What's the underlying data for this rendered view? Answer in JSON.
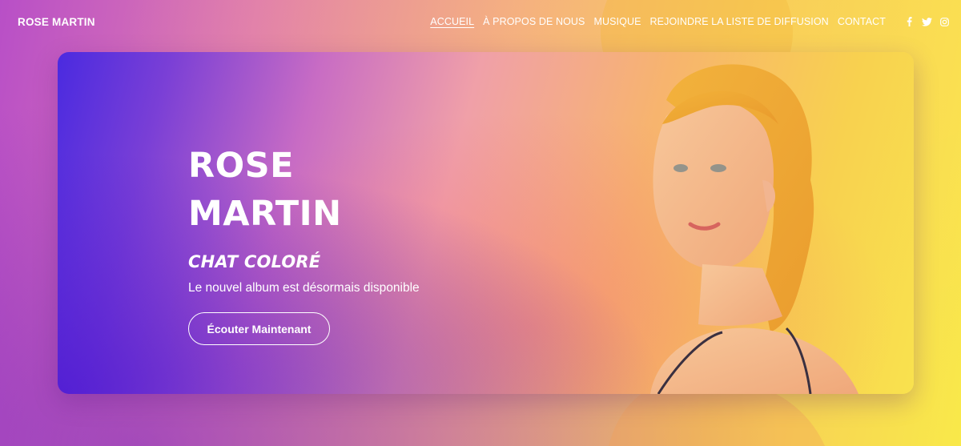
{
  "header": {
    "logo": "ROSE MARTIN",
    "nav": [
      {
        "label": "ACCUEIL",
        "active": true
      },
      {
        "label": "À PROPOS DE NOUS",
        "active": false
      },
      {
        "label": "MUSIQUE",
        "active": false
      },
      {
        "label": "REJOINDRE LA LISTE DE DIFFUSION",
        "active": false
      },
      {
        "label": "CONTACT",
        "active": false
      }
    ],
    "social": [
      {
        "icon": "facebook-icon",
        "glyph": "f"
      },
      {
        "icon": "twitter-icon",
        "glyph": "🐦"
      },
      {
        "icon": "instagram-icon",
        "glyph": "◎"
      }
    ]
  },
  "hero": {
    "name_line1": "ROSE",
    "name_line2": "MARTIN",
    "album_title": "CHAT COLORÉ",
    "album_subtitle": "Le nouvel album est désormais disponible",
    "cta_label": "Écouter Maintenant"
  },
  "colors": {
    "accent_purple": "#4a2ae0",
    "accent_pink": "#f0a0a8",
    "accent_yellow": "#f9e24e",
    "text": "#ffffff"
  }
}
